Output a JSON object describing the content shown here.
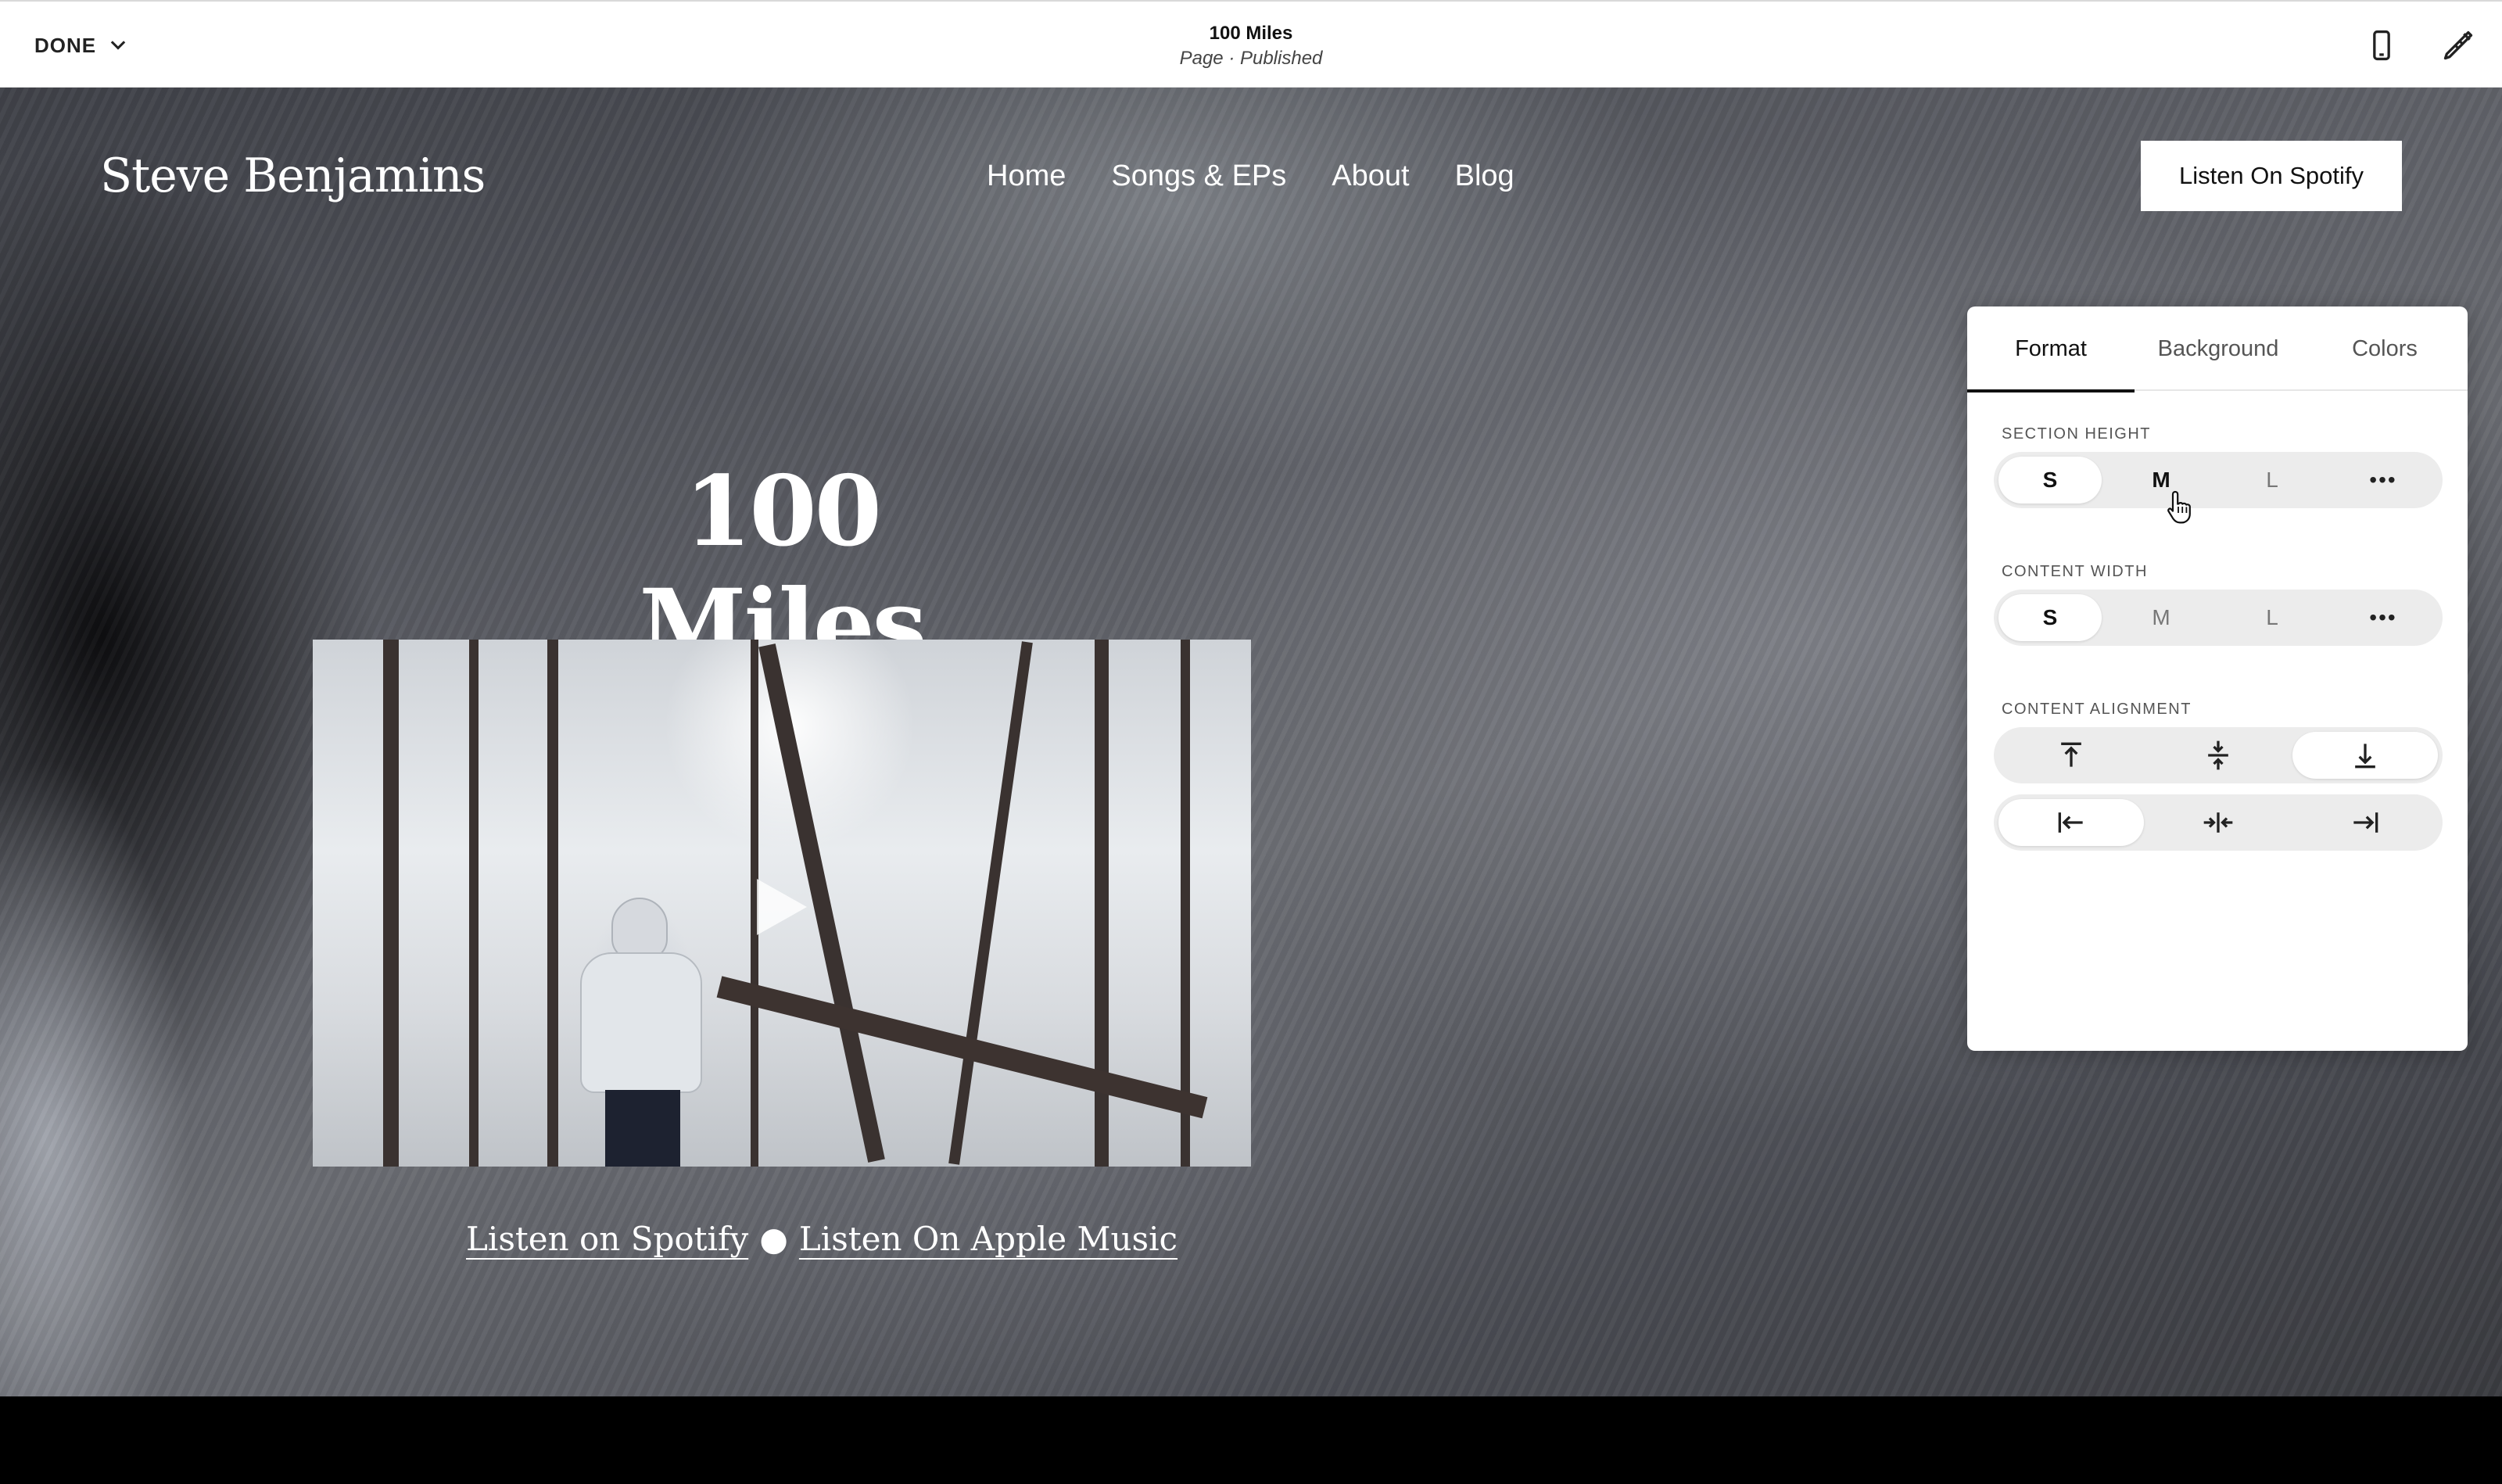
{
  "topbar": {
    "done_label": "DONE",
    "page_title": "100 Miles",
    "page_status": "Page · Published",
    "icons": [
      "chevron-down-icon",
      "mobile-preview-icon",
      "site-styles-icon"
    ]
  },
  "site": {
    "logo": "Steve Benjamins",
    "nav": [
      "Home",
      "Songs & EPs",
      "About",
      "Blog"
    ],
    "cta_label": "Listen On Spotify",
    "hero_title": "100 Miles",
    "links": {
      "spotify": "Listen on Spotify",
      "separator": "●",
      "apple": "Listen On Apple Music"
    }
  },
  "panel": {
    "tabs": [
      "Format",
      "Background",
      "Colors"
    ],
    "active_tab": "Format",
    "section_height": {
      "label": "SECTION HEIGHT",
      "options": [
        "S",
        "M",
        "L",
        "•••"
      ],
      "selected": "S"
    },
    "content_width": {
      "label": "CONTENT WIDTH",
      "options": [
        "S",
        "M",
        "L",
        "•••"
      ],
      "selected": "S"
    },
    "content_alignment": {
      "label": "CONTENT ALIGNMENT",
      "vertical": [
        "align-top-icon",
        "align-middle-icon",
        "align-bottom-icon"
      ],
      "vertical_selected": "align-bottom-icon",
      "horizontal": [
        "align-left-icon",
        "align-center-icon",
        "align-right-icon"
      ],
      "horizontal_selected": "align-left-icon"
    }
  },
  "colors": {
    "panel_bg": "#ffffff",
    "segment_bg": "#ececec",
    "text_dark": "#111111"
  }
}
